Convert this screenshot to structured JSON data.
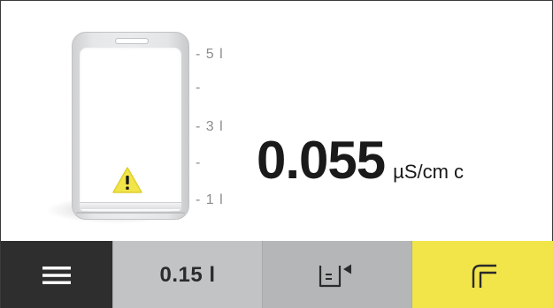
{
  "tank": {
    "scale": [
      {
        "label": "- 5 l"
      },
      {
        "label": "-"
      },
      {
        "label": "- 3 l"
      },
      {
        "label": "-"
      },
      {
        "label": "- 1 l"
      }
    ],
    "warning_icon": "warning-triangle-icon"
  },
  "reading": {
    "value": "0.055",
    "unit": "µS/cm c"
  },
  "toolbar": {
    "menu_icon": "hamburger-menu-icon",
    "volume_label": "0.15 l",
    "fill_icon": "beaker-dispense-icon",
    "tap_icon": "faucet-icon"
  },
  "colors": {
    "menu_bg": "#2e2e2e",
    "volume_bg": "#c2c3c5",
    "fill_bg": "#b5b6b8",
    "tap_bg": "#f2e54a",
    "warning": "#f2e54a"
  }
}
